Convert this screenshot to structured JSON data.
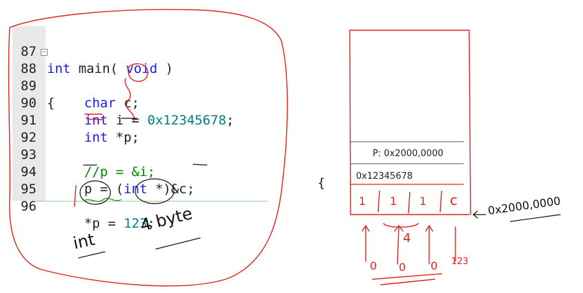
{
  "editor": {
    "lines": [
      {
        "num": "87",
        "t1": "int",
        "t2": " main( ",
        "t3": "void",
        "t4": " )"
      },
      {
        "num": "88",
        "fold": "⊟",
        "t1": "{"
      },
      {
        "num": "89",
        "t1": "char",
        "t2": " c;"
      },
      {
        "num": "90",
        "t1": "int",
        "t2": " i = ",
        "t3": "0x12345678",
        "t4": ";"
      },
      {
        "num": "91",
        "t1": "int",
        "t2": " *p;"
      },
      {
        "num": "92"
      },
      {
        "num": "93",
        "t1": "//p = &i;"
      },
      {
        "num": "94",
        "t1": "p = (",
        "t2": "int",
        "t3": " *)&c;"
      },
      {
        "num": "95"
      },
      {
        "num": "96",
        "t1": "*p = ",
        "t2": "123",
        "t3": ";"
      }
    ]
  },
  "annotations": {
    "int_note": "int",
    "byte_note": "4 byte",
    "bracket_mark": "{"
  },
  "memory": {
    "p_cell": "P: 0x2000,0000",
    "i_cell": "0x12345678",
    "byte_cells": [
      "1",
      "1",
      "1",
      "c"
    ],
    "address_label": "0x2000,0000",
    "span_label": "4",
    "zeros": [
      "0",
      "0",
      "0"
    ],
    "value_label": "123"
  },
  "colors": {
    "ink": "#e0231e",
    "keyword": "#1a1aff",
    "number": "#008080",
    "comment": "#008800"
  }
}
